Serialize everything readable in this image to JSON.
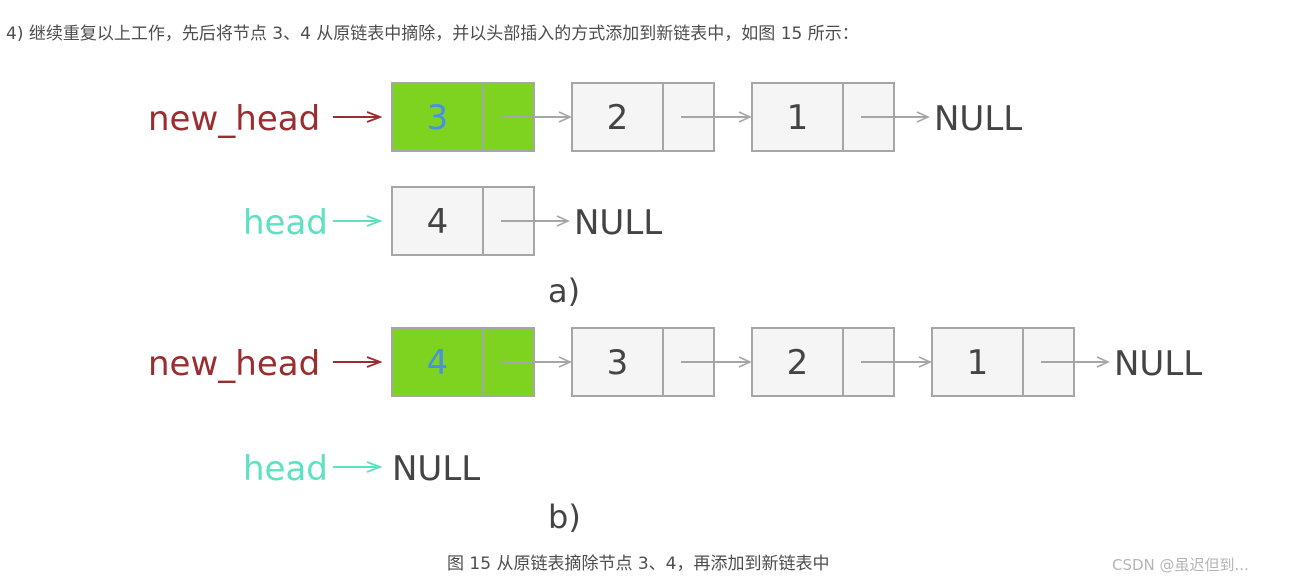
{
  "paragraph": "4) 继续重复以上工作，先后将节点 3、4 从原链表中摘除，并以头部插入的方式添加到新链表中，如图 15 所示：",
  "figure": {
    "caption": "图 15 从原链表摘除节点 3、4，再添加到新链表中",
    "colors": {
      "new_head_label": "#9b2c2f",
      "head_label": "#5ee0c3",
      "highlight_fill": "#7ed321",
      "highlight_text": "#4a90e2",
      "node_fill": "#f5f5f5",
      "node_border": "#a6a6a6",
      "arrow": "#a6a6a6",
      "text": "#444444"
    },
    "panels": [
      {
        "sublabel": "a)",
        "new_head": {
          "label": "new_head",
          "nodes": [
            "3",
            "2",
            "1"
          ],
          "highlighted_index": 0,
          "terminal": "NULL"
        },
        "head": {
          "label": "head",
          "nodes": [
            "4"
          ],
          "terminal": "NULL"
        }
      },
      {
        "sublabel": "b)",
        "new_head": {
          "label": "new_head",
          "nodes": [
            "4",
            "3",
            "2",
            "1"
          ],
          "highlighted_index": 0,
          "terminal": "NULL"
        },
        "head": {
          "label": "head",
          "nodes": [],
          "terminal": "NULL"
        }
      }
    ]
  },
  "watermark": "CSDN @虽迟但到..."
}
